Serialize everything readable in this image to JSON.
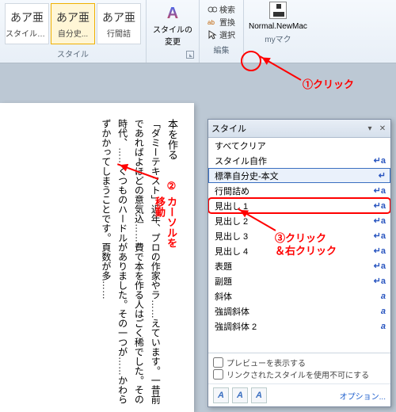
{
  "ribbon": {
    "gallery": [
      {
        "sample": "あア亜",
        "label": "スタイル自作",
        "selected": false
      },
      {
        "sample": "あア亜",
        "label": "自分史...",
        "selected": true
      },
      {
        "sample": "あア亜",
        "label": "行間詰",
        "selected": false
      }
    ],
    "group_style_caption": "スタイル",
    "change_style_label": "スタイルの変更",
    "edit": {
      "find": "検索",
      "replace": "置換",
      "select": "選択"
    },
    "edit_caption": "編集",
    "macro_label": "Normal.NewMac",
    "macro_caption": "myマク"
  },
  "annotations": {
    "step1": "①クリック",
    "step2a": "②",
    "step2b": "カーソルを",
    "step2c": "移動",
    "step3a": "③クリック",
    "step3b": "＆右クリック"
  },
  "doc": {
    "title": "本を作る",
    "body": "「ダミーテキスト」近年、プロの作家やラ……えています。一昔前であればよほどの意気込……費で本を作る人はごく稀でした。その時代、……くつものハードルがありました。その一つが……かわらずかかってしまうことです。頁数が多……"
  },
  "pane": {
    "title": "スタイル",
    "items": [
      {
        "label": "すべてクリア",
        "glyph": ""
      },
      {
        "label": "スタイル自作",
        "glyph": "↵a"
      },
      {
        "label": "標準自分史-本文",
        "glyph": "↵",
        "selected": true
      },
      {
        "label": "行間詰め",
        "glyph": "↵a"
      },
      {
        "label": "見出し 1",
        "glyph": "↵a",
        "ring": true
      },
      {
        "label": "見出し 2",
        "glyph": "↵a"
      },
      {
        "label": "見出し 3",
        "glyph": "↵a"
      },
      {
        "label": "見出し 4",
        "glyph": "↵a"
      },
      {
        "label": "表題",
        "glyph": "↵a"
      },
      {
        "label": "副題",
        "glyph": "↵a"
      },
      {
        "label": "斜体",
        "glyph": "a"
      },
      {
        "label": "強調斜体",
        "glyph": "a"
      },
      {
        "label": "強調斜体 2",
        "glyph": "a"
      }
    ],
    "show_preview": "プレビューを表示する",
    "disable_linked": "リンクされたスタイルを使用不可にする",
    "options": "オプション..."
  }
}
